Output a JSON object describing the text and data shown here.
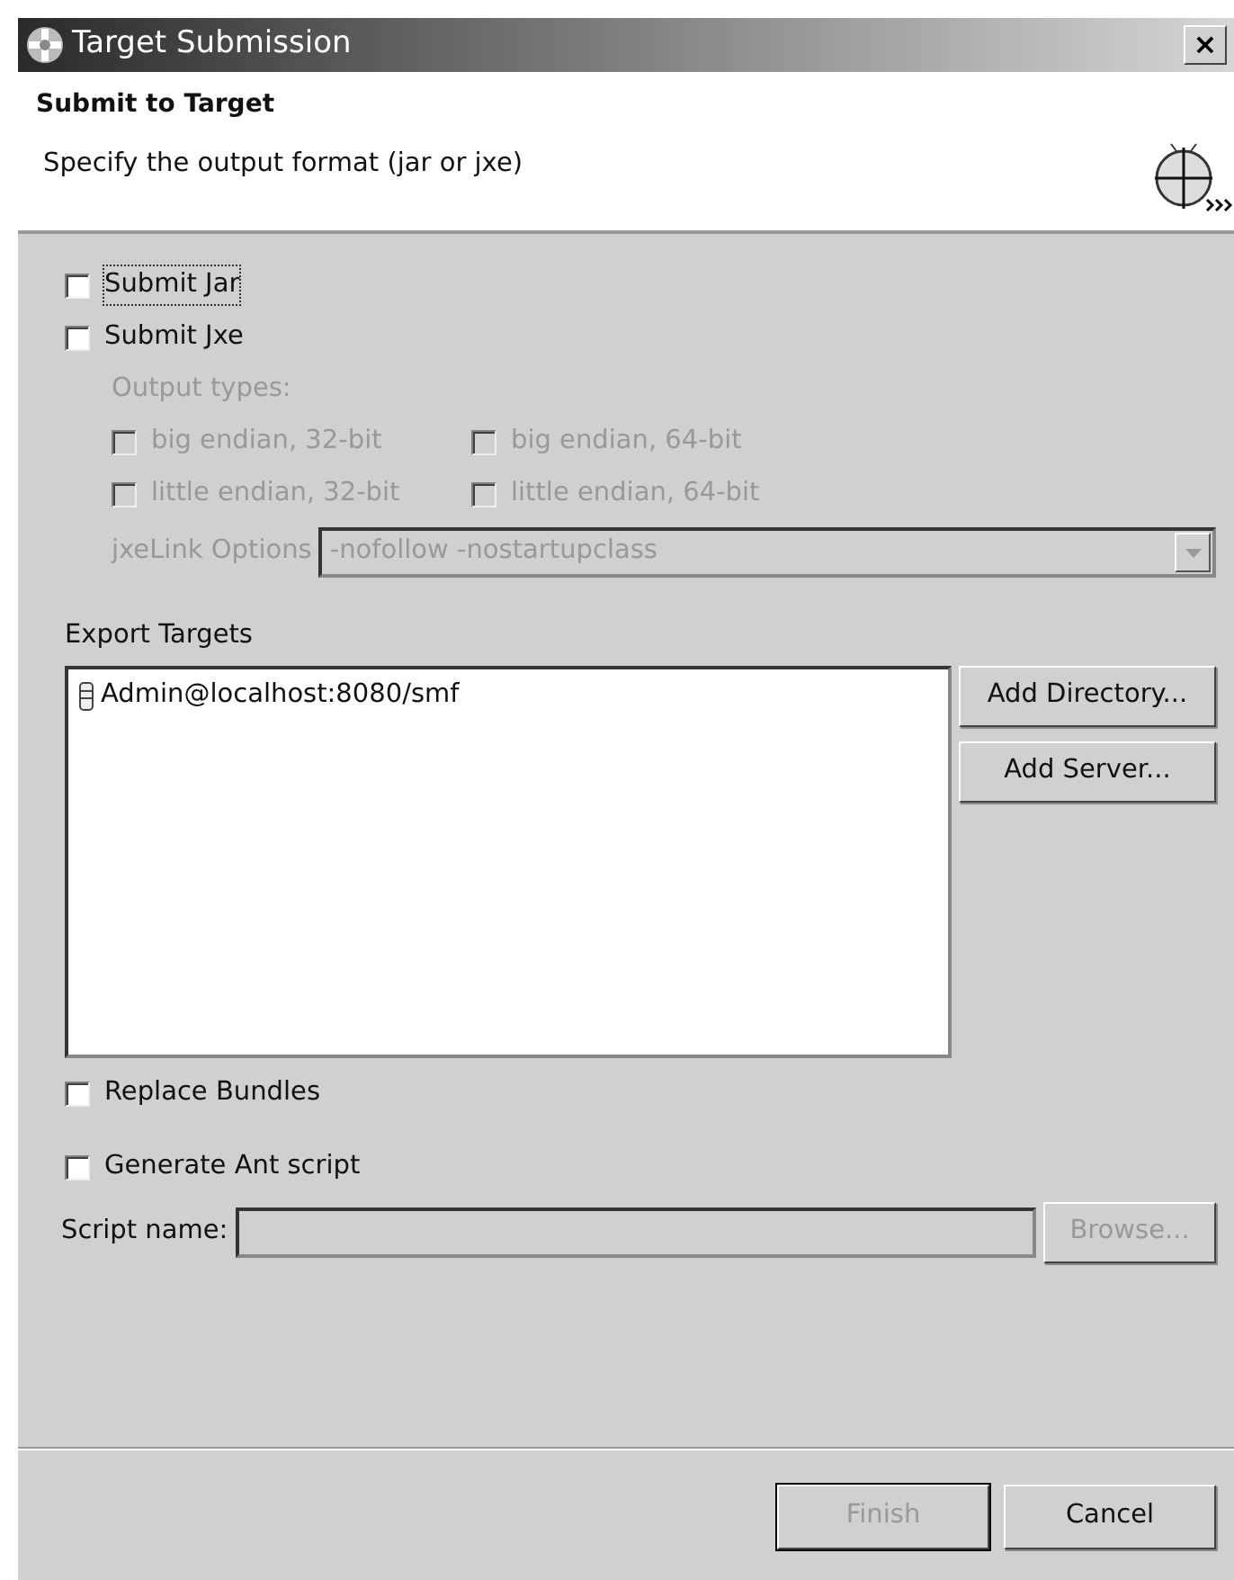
{
  "window": {
    "title": "Target Submission",
    "close": "×"
  },
  "header": {
    "title": "Submit to Target",
    "description": "Specify the output format (jar or jxe)"
  },
  "options": [
    {
      "label": "Submit Jar",
      "checked": false,
      "disabled": false,
      "focused": true
    },
    {
      "label": "Submit Jxe",
      "checked": false,
      "disabled": false,
      "focused": false
    }
  ],
  "output_types": {
    "label": "Output types:",
    "disabled": true,
    "items": [
      {
        "label": "big endian, 32-bit",
        "checked": false
      },
      {
        "label": "big endian, 64-bit",
        "checked": false
      },
      {
        "label": "little endian, 32-bit",
        "checked": false
      },
      {
        "label": "little endian, 64-bit",
        "checked": false
      }
    ]
  },
  "jxelink": {
    "label": "jxeLink Options",
    "value": "-nofollow -nostartupclass",
    "disabled": true
  },
  "export_targets": {
    "label": "Export Targets",
    "items": [
      {
        "label": "Admin@localhost:8080/smf",
        "selected": false
      }
    ],
    "buttons": [
      {
        "label": "Add Directory...",
        "disabled": false
      },
      {
        "label": "Add Server...",
        "disabled": false
      }
    ]
  },
  "replace_bundles": {
    "label": "Replace Bundles",
    "checked": false
  },
  "generate_ant": {
    "label": "Generate Ant script",
    "checked": false
  },
  "script_name": {
    "label": "Script name:",
    "disabled": true,
    "browse": {
      "label": "Browse...",
      "disabled": true
    }
  },
  "footer_buttons": [
    {
      "label": "Finish",
      "disabled": true,
      "default": true
    },
    {
      "label": "Cancel",
      "disabled": false,
      "default": false
    }
  ]
}
